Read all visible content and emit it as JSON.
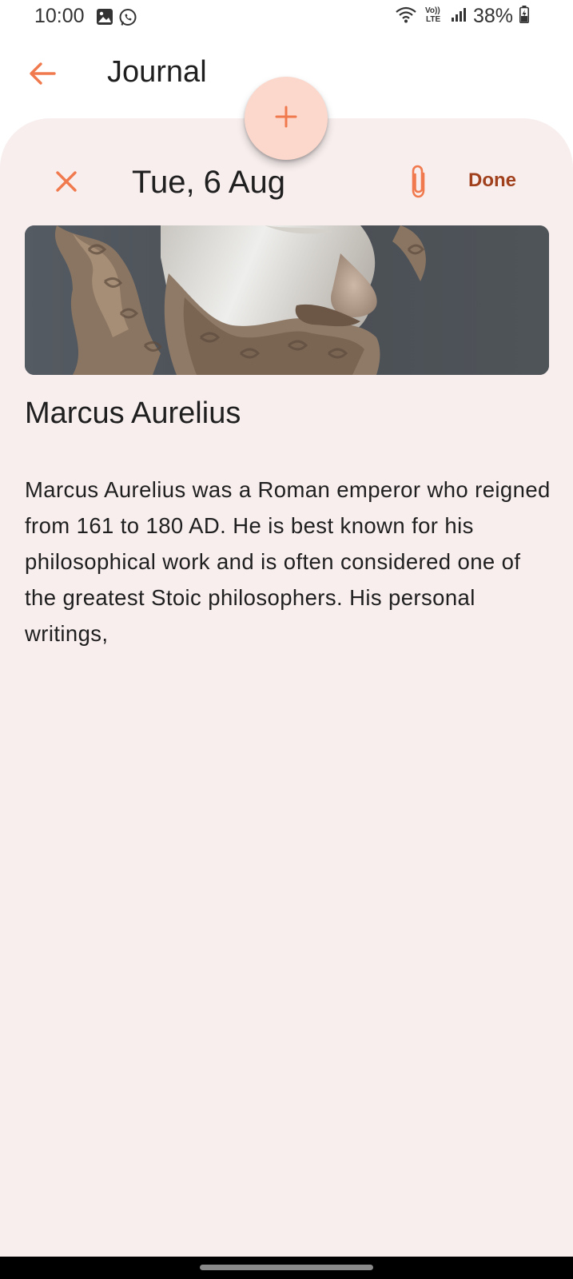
{
  "status_bar": {
    "time": "10:00",
    "battery": "38%",
    "left_icons": [
      "gallery-notification-icon",
      "whatsapp-notification-icon"
    ],
    "right_icons": [
      "wifi-icon",
      "volte-icon",
      "signal-icon",
      "battery-charging-icon"
    ]
  },
  "app_bar": {
    "title": "Journal",
    "back_icon": "arrow-left-icon"
  },
  "fab": {
    "icon": "plus-icon"
  },
  "editor": {
    "date": "Tue, 6 Aug",
    "done_label": "Done",
    "close_icon": "close-icon",
    "attach_icon": "paperclip-icon"
  },
  "entry": {
    "image": "marble-bust-photo",
    "title": "Marcus Aurelius",
    "body": "Marcus Aurelius was a Roman emperor who reigned from 161 to 180 AD. He is best known for his philosophical work and is often considered one of the greatest Stoic philosophers. His personal writings,"
  },
  "colors": {
    "accent": "#f07a4e",
    "done": "#a0401c",
    "sheet_bg": "#f8eeee",
    "fab_bg": "#fcd7cb"
  }
}
